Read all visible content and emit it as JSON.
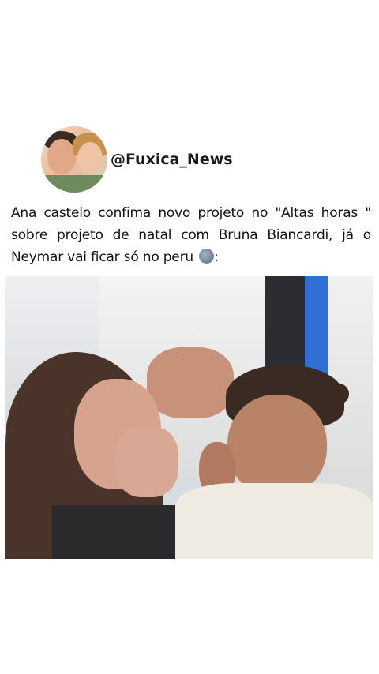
{
  "post": {
    "account_handle": "@Fuxica_News",
    "avatar_icon": "profile-photo-couple",
    "caption_text": "Ana castelo  confima novo projeto no \"Altas horas \" sobre projeto de natal com Bruna Biancardi,  já o Neymar vai ficar só no peru",
    "caption_emoji": "new-moon-face-emoji",
    "caption_suffix": ":"
  },
  "colors": {
    "background": "#ffffff",
    "text": "#111111"
  }
}
